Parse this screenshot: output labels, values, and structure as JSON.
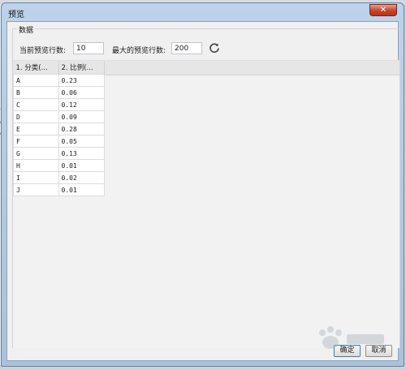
{
  "dialog": {
    "title": "预览",
    "close_symbol": "✕"
  },
  "background_fragments": [
    "可",
    "e",
    "e"
  ],
  "group": {
    "legend": "数据"
  },
  "settings": {
    "current_rows_label": "当前预览行数:",
    "current_rows_value": "10",
    "max_rows_label": "最大的预览行数:",
    "max_rows_value": "200",
    "refresh_icon": "refresh-icon"
  },
  "table": {
    "headers": [
      "1. 分类(...",
      "2. 比例(..."
    ],
    "rows": [
      [
        "A",
        "0.23"
      ],
      [
        "B",
        "0.06"
      ],
      [
        "C",
        "0.12"
      ],
      [
        "D",
        "0.09"
      ],
      [
        "E",
        "0.28"
      ],
      [
        "F",
        "0.05"
      ],
      [
        "G",
        "0.13"
      ],
      [
        "H",
        "0.01"
      ],
      [
        "I",
        "0.02"
      ],
      [
        "J",
        "0.01"
      ]
    ]
  },
  "footer": {
    "ok_label": "确定",
    "cancel_label": "取消"
  },
  "colors": {
    "title_bar": "#bcd3ea",
    "close_button": "#c7432b",
    "client_bg": "#f0f0f0",
    "table_header_bg": "#e6e6e6"
  }
}
